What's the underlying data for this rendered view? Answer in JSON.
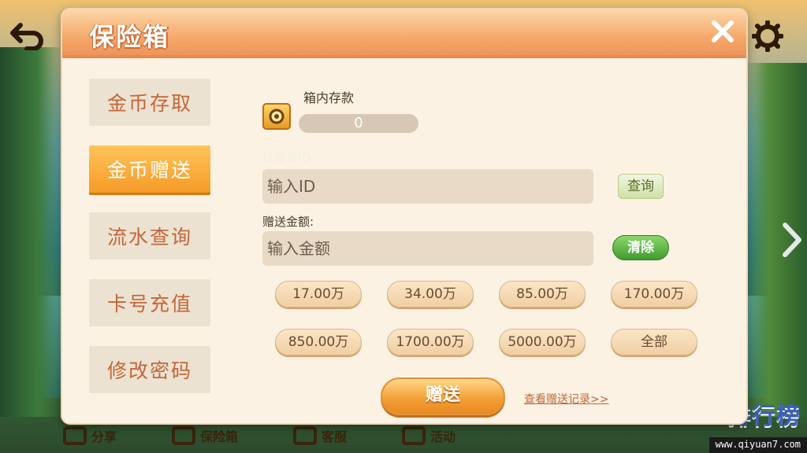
{
  "dialog": {
    "title": "保险箱"
  },
  "side_menu": {
    "items": [
      {
        "label": "金币存取",
        "active": false
      },
      {
        "label": "金币赠送",
        "active": true
      },
      {
        "label": "流水查询",
        "active": false
      },
      {
        "label": "卡号充值",
        "active": false
      },
      {
        "label": "修改密码",
        "active": false
      }
    ]
  },
  "vault": {
    "label": "箱内存款",
    "value": "0"
  },
  "receiver": {
    "label": "接受者ID",
    "placeholder": "输入ID",
    "query_label": "查询"
  },
  "amount": {
    "label": "赠送金额:",
    "placeholder": "输入金额",
    "clear_label": "清除",
    "chips": [
      "17.00万",
      "34.00万",
      "85.00万",
      "170.00万",
      "850.00万",
      "1700.00万",
      "5000.00万",
      "全部"
    ]
  },
  "actions": {
    "send_label": "赠送",
    "history_link": "查看赠送记录>>"
  },
  "bottom_bar": {
    "items": [
      "分享",
      "保险箱",
      "客服",
      "活动"
    ],
    "rank_label": "排行榜"
  },
  "watermark": "www.qiyuan7.com",
  "colors": {
    "accent_orange": "#f59a28",
    "menu_text": "#c4663a",
    "clear_green": "#3f9b2e"
  }
}
